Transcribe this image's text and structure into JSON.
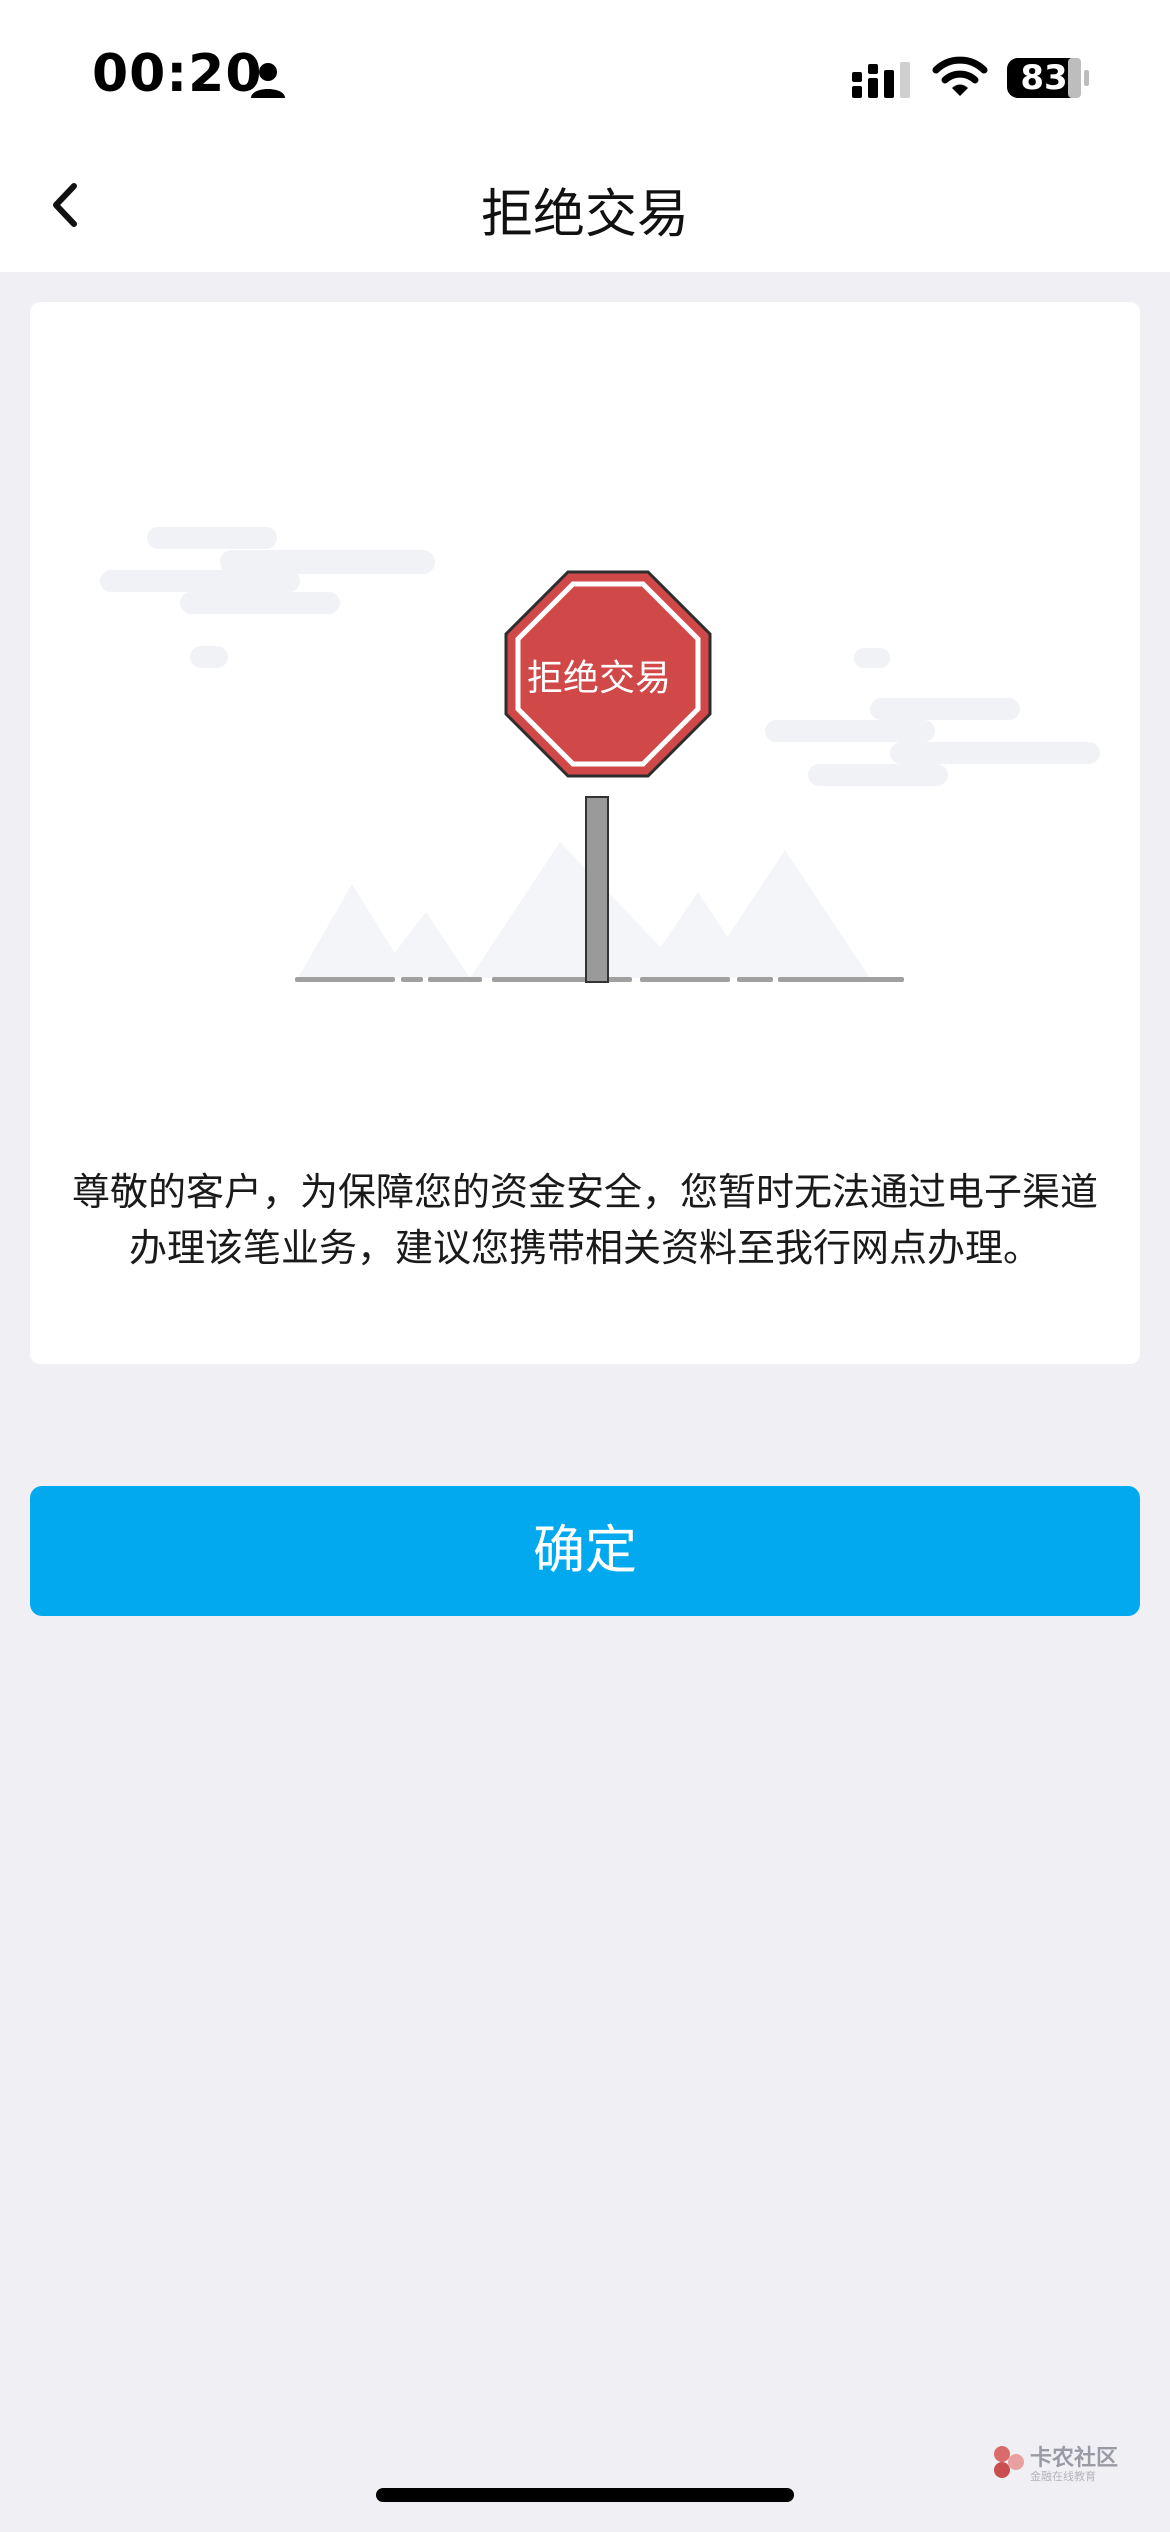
{
  "status_bar": {
    "time": "00:20",
    "battery": "83",
    "icons": [
      "person-icon",
      "signal-icon",
      "wifi-icon",
      "battery-icon"
    ]
  },
  "nav": {
    "title": "拒绝交易",
    "back_icon": "chevron-left-icon"
  },
  "illustration": {
    "sign_text": "拒绝交易",
    "sign_color": "#d44a4a",
    "pole_color": "#999999"
  },
  "message": "尊敬的客户，为保障您的资金安全，您暂时无法通过电子渠道办理该笔业务，建议您携带相关资料至我行网点办理。",
  "confirm_button": {
    "label": "确定",
    "color": "#03a9ee"
  },
  "watermark": {
    "title": "卡农社区",
    "subtitle": "金融在线教育"
  }
}
